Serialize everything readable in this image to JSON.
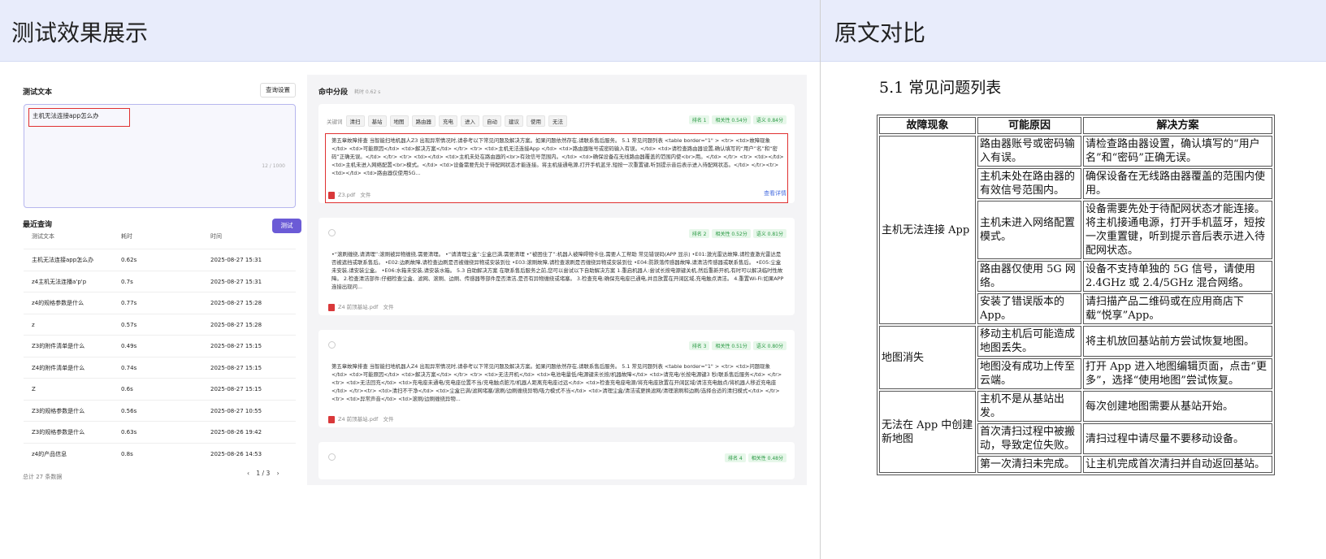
{
  "banner": {
    "left_title": "测试效果展示",
    "right_title": "原文对比"
  },
  "left": {
    "title": "测试文本",
    "query_settings": "查询设置",
    "query_text": "主机无法连接app怎么办",
    "char_count": "12 / 1000",
    "test_button": "测试",
    "recent_title": "最近查询",
    "columns": [
      "测试文本",
      "耗时",
      "时间"
    ],
    "rows": [
      [
        "主机无法连接app怎么办",
        "0.62s",
        "2025-08-27 15:31"
      ],
      [
        "z4主机无法连播a'p'p",
        "0.7s",
        "2025-08-27 15:31"
      ],
      [
        "z4的规格参数是什么",
        "0.77s",
        "2025-08-27 15:28"
      ],
      [
        "z",
        "0.57s",
        "2025-08-27 15:28"
      ],
      [
        "Z3的附件清单是什么",
        "0.49s",
        "2025-08-27 15:15"
      ],
      [
        "Z4的附件清单是什么",
        "0.74s",
        "2025-08-27 15:15"
      ],
      [
        "Z",
        "0.6s",
        "2025-08-27 15:15"
      ],
      [
        "Z3的规格参数是什么",
        "0.56s",
        "2025-08-27 10:55"
      ],
      [
        "Z3的规格参数是什么",
        "0.63s",
        "2025-08-26 19:42"
      ],
      [
        "z4的产品信息",
        "0.8s",
        "2025-08-26 14:53"
      ]
    ],
    "total": "总计 27 条数据",
    "page": "1 / 3",
    "prev": "‹",
    "next": "›"
  },
  "hits": {
    "title": "命中分段",
    "time": "耗时 0.62 s",
    "keywords_label": "关键词",
    "keywords": [
      "清扫",
      "基站",
      "地图",
      "路由器",
      "充电",
      "进入",
      "自动",
      "建议",
      "使用",
      "无法"
    ],
    "detail": "查看详情",
    "file_type": "文件",
    "cards": [
      {
        "rank": "排名 1",
        "relevance": "相关性 0.54分",
        "semantic": "语义 0.84分",
        "file": "Z3.pdf",
        "text": "第五章故障排查 当智能扫地机器人Z3 出现异常情况时,请参考以下常见问题及解决方案。如果问题依然存在,请联系售后服务。 5.1 常见问题列表 <table border=\"1\" > <tr> <td>故障现象</td> <td>可能原因</td> <td>解决方案</td> </tr> <tr> <td>主机无法连接App </td> <td>路由器账号或密码输入有误。</td> <td>请检查路由器设置,确认填写的“用户”名”和“密码”正确无误。</td> </tr> <tr> <td></td> <td>主机未处在路由器的<br>有效信号范围内。</td> <td>确保设备在无线路由器覆盖的范围内使<br>用。</td> </tr> <tr> <td></td> <td>主机未进入网络配置<br>模式。</td> <td>设备需要先处于待配网状态才能连接。将主机接通电源,打开手机蓝牙,短按一次重置键,听到提示音后表示进入待配网状态。</td> </tr><tr> <td></td> <td>路由器仅使用5G..."
      },
      {
        "rank": "排名 2",
        "relevance": "相关性 0.52分",
        "semantic": "语义 0.81分",
        "file": "Z4 前顶基站.pdf",
        "text": "•“滚刷缠绕,请清理”:滚刷被异物缠绕,需要清理。 •“请清理尘盒”:尘盒已满,需要清理 •“被困住了”:机器人被障碍物卡住,需要人工帮助 常见错误码(APP 显示) •E01:激光雷达故障,请检查激光雷达是否被遮挡或联系售后。 •E02:边刷故障,请检查边刷是否被缠绕异物或安装到位 •E03:滚刷故障,请检查滚刷是否缠绕异物或安装到位 •E04:防跌落传感器故障,请清洁传感器或联系售后。 •E05:尘盒未安装,请安装尘盒。 •E06:水箱未安装,请安装水箱。 5.3 自助解决方案 在联系售后服务之前,您可以尝试以下自助解决方案 1.重启机器人:尝试长按电源键关机,然后重新开机,有时可以解决临时性故障。 2.检查清洁部件:仔细检查尘盒、滤网、滚刷、边刷、传感器等部件是否清洁,是否有异物缠绕或堵塞。 3.检查充电:确保充电座已通电,并且放置在开阔区域,充电触点清洁。 4.重置Wi-Fi:如果APP 连接出现问..."
      },
      {
        "rank": "排名 3",
        "relevance": "相关性 0.51分",
        "semantic": "语义 0.80分",
        "file": "Z4 前顶基站.pdf",
        "text": "第五章故障排查 当智能扫地机器人Z4 出现异常情况时,请参考以下常见问题及解决方案。如果问题依然存在,请联系售后服务。 5.1 常见问题列表 <table border=\"1\" > <tr> <td>问题现象</td> <td>可能原因</td> <td>解决方案</td> </tr> <tr> <td>无法开机</td> <td>电池电量低/电源键未长按/机器故障</td> <td>请充电/长按电源键3 秒/联系售后服务</td> </tr><tr> <td>无法回充</td> <td>充电座未通电/充电座位置不当/充电触点脏污/机器人距离充电座过远</td> <td>检查充电座电源/将充电座放置在开阔区域/清洁充电触点/将机器人移近充电座</td> </tr><tr> <td>清扫不干净</td> <td>尘盒已满/滤网堵塞/滚刷/边刷缠绕异物/吸力模式不当</td> <td>清理尘盒/清洁或更换滤网/清理滚刷和边刷/选择合适的清扫模式</td> </tr><tr> <td>异常声音</td> <td>滚刷/边刷缠绕异物..."
      },
      {
        "rank": "排名 4",
        "relevance": "相关性 0.48分",
        "semantic": "",
        "file": "",
        "text": ""
      }
    ]
  },
  "original": {
    "title": "5.1 常见问题列表",
    "headers": [
      "故障现象",
      "可能原因",
      "解决方案"
    ],
    "rows": [
      [
        "主机无法连接 App",
        "路由器账号或密码输入有误。",
        "请检查路由器设置，确认填写的“用户名”和“密码”正确无误。"
      ],
      [
        "",
        "主机未处在路由器的有效信号范围内。",
        "确保设备在无线路由器覆盖的范围内使用。"
      ],
      [
        "",
        "主机未进入网络配置模式。",
        "设备需要先处于待配网状态才能连接。将主机接通电源，打开手机蓝牙，短按一次重置键，听到提示音后表示进入待配网状态。"
      ],
      [
        "",
        "路由器仅使用 5G 网络。",
        "设备不支持单独的 5G 信号，请使用 2.4GHz 或 2.4/5GHz 混合网络。"
      ],
      [
        "",
        "安装了错误版本的 App。",
        "请扫描产品二维码或在应用商店下载“悦享”App。"
      ],
      [
        "地图消失",
        "移动主机后可能造成地图丢失。",
        "将主机放回基站前方尝试恢复地图。"
      ],
      [
        "",
        "地图没有成功上传至云端。",
        "打开 App 进入地图编辑页面，点击“更多”，选择“使用地图”尝试恢复。"
      ],
      [
        "无法在 App 中创建新地图",
        "主机不是从基站出发。",
        "每次创建地图需要从基站开始。"
      ],
      [
        "",
        "首次清扫过程中被搬动，导致定位失败。",
        "清扫过程中请尽量不要移动设备。"
      ],
      [
        "",
        "第一次清扫未完成。",
        "让主机完成首次清扫并自动返回基站。"
      ]
    ]
  }
}
